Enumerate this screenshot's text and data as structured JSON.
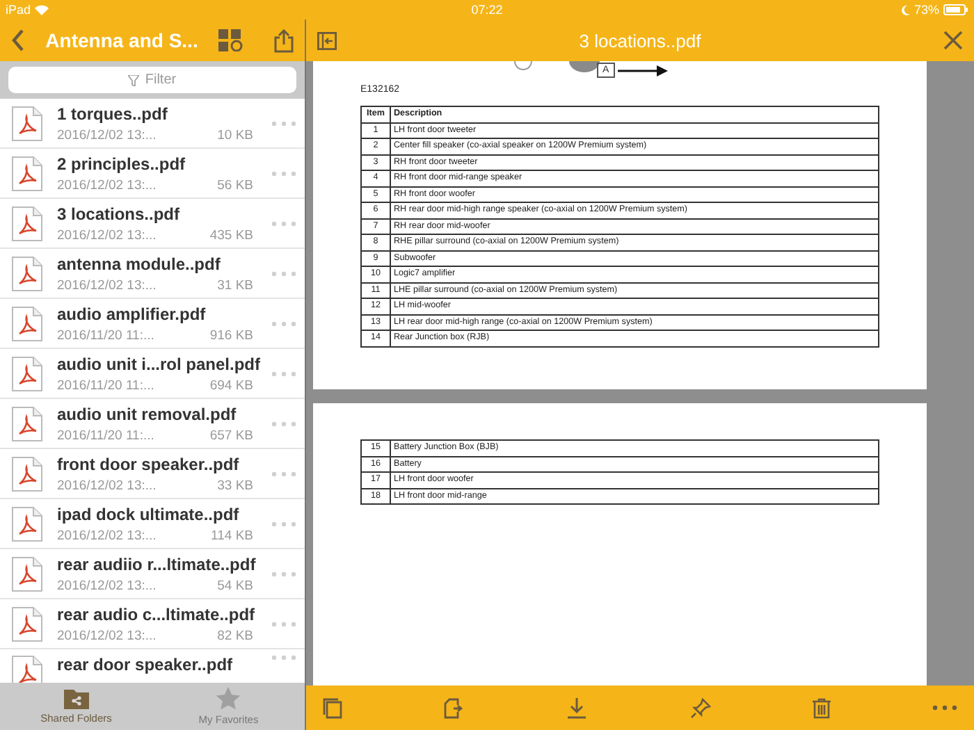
{
  "status_bar": {
    "device": "iPad",
    "time": "07:22",
    "battery": "73%"
  },
  "sidebar": {
    "title": "Antenna and S...",
    "filter": {
      "placeholder": "Filter"
    },
    "files": [
      {
        "name": "1 torques..pdf",
        "date": "2016/12/02 13:...",
        "size": "10 KB",
        "selected": false
      },
      {
        "name": "2 principles..pdf",
        "date": "2016/12/02 13:...",
        "size": "56 KB",
        "selected": false
      },
      {
        "name": "3 locations..pdf",
        "date": "2016/12/02 13:...",
        "size": "435 KB",
        "selected": false
      },
      {
        "name": "antenna module..pdf",
        "date": "2016/12/02 13:...",
        "size": "31 KB",
        "selected": false
      },
      {
        "name": "audio amplifier.pdf",
        "date": "2016/11/20 11:...",
        "size": "916 KB",
        "selected": false
      },
      {
        "name": "audio unit i...rol panel.pdf",
        "date": "2016/11/20 11:...",
        "size": "694 KB",
        "selected": false
      },
      {
        "name": "audio unit removal.pdf",
        "date": "2016/11/20 11:...",
        "size": "657 KB",
        "selected": false
      },
      {
        "name": "front door speaker..pdf",
        "date": "2016/12/02 13:...",
        "size": "33 KB",
        "selected": false
      },
      {
        "name": "ipad dock ultimate..pdf",
        "date": "2016/12/02 13:...",
        "size": "114 KB",
        "selected": false
      },
      {
        "name": "rear audiio r...ltimate..pdf",
        "date": "2016/12/02 13:...",
        "size": "54 KB",
        "selected": false
      },
      {
        "name": "rear audio c...ltimate..pdf",
        "date": "2016/12/02 13:...",
        "size": "82 KB",
        "selected": false
      },
      {
        "name": "rear door speaker..pdf",
        "selected": false
      }
    ],
    "tabs": [
      {
        "label": "Shared Folders",
        "kind": "folder",
        "selected": true
      },
      {
        "label": "My Favorites",
        "kind": "star",
        "selected": false
      }
    ]
  },
  "viewer": {
    "title": "3 locations..pdf",
    "pages": [
      {
        "figure_callout": "A",
        "figure_id": "E132162",
        "columns": [
          "Item",
          "Description"
        ],
        "rows": [
          [
            "1",
            "LH front door tweeter"
          ],
          [
            "2",
            "Center fill speaker (co-axial speaker on 1200W Premium system)"
          ],
          [
            "3",
            "RH front door tweeter"
          ],
          [
            "4",
            "RH front door mid-range speaker"
          ],
          [
            "5",
            "RH front door woofer"
          ],
          [
            "6",
            "RH rear door mid-high range speaker (co-axial on 1200W Premium system)"
          ],
          [
            "7",
            "RH rear door mid-woofer"
          ],
          [
            "8",
            "RHE pillar surround (co-axial on 1200W Premium system)"
          ],
          [
            "9",
            "Subwoofer"
          ],
          [
            "10",
            "Logic7 amplifier"
          ],
          [
            "11",
            "LHE pillar surround (co-axial on 1200W Premium system)"
          ],
          [
            "12",
            "LH mid-woofer"
          ],
          [
            "13",
            "LH rear door mid-high range (co-axial on 1200W Premium system)"
          ],
          [
            "14",
            "Rear Junction box (RJB)"
          ]
        ]
      },
      {
        "rows": [
          [
            "15",
            "Battery Junction Box (BJB)"
          ],
          [
            "16",
            "Battery"
          ],
          [
            "17",
            "LH front door woofer"
          ],
          [
            "18",
            "LH front door mid-range"
          ]
        ]
      }
    ]
  }
}
